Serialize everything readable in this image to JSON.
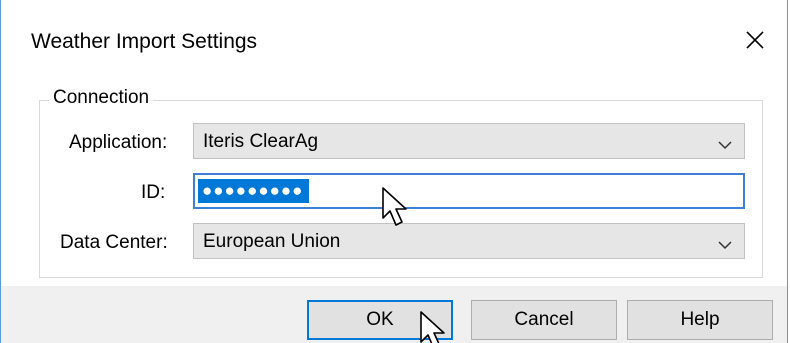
{
  "dialog": {
    "title": "Weather Import Settings"
  },
  "connection": {
    "legend": "Connection",
    "application": {
      "label": "Application:",
      "value": "Iteris ClearAg"
    },
    "id": {
      "label": "ID:",
      "value": "●●●●●●●●●"
    },
    "data_center": {
      "label": "Data Center:",
      "value": "European Union"
    }
  },
  "buttons": {
    "ok": "OK",
    "cancel": "Cancel",
    "help": "Help"
  },
  "icons": {
    "close": "close-icon",
    "dropdown": "chevron-down-icon",
    "cursor": "mouse-pointer-icon"
  },
  "colors": {
    "accent": "#0078d7",
    "focus_border": "#3c7fd4",
    "combo_background": "#e6e6e6",
    "footer_background": "#f0f0f0"
  }
}
